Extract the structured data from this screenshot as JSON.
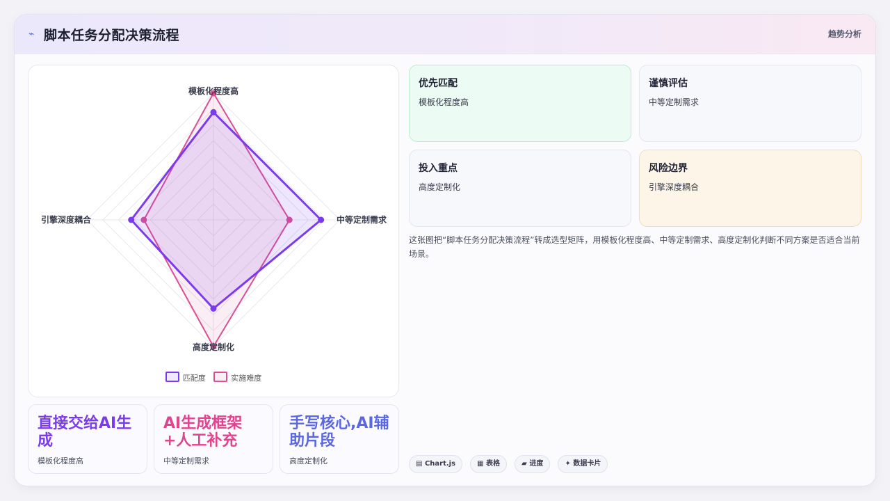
{
  "header": {
    "title": "脚本任务分配决策流程",
    "link": "趋势分析"
  },
  "chart_data": {
    "type": "radar",
    "axes": [
      "模板化程度高",
      "中等定制需求",
      "高度定制化",
      "引擎深度耦合"
    ],
    "scale_max": 10,
    "series": [
      {
        "name": "匹配度",
        "values": [
          8.5,
          8.5,
          7,
          6.5
        ],
        "color": "#7c3aed"
      },
      {
        "name": "实施难度",
        "values": [
          10,
          6,
          10,
          5.5
        ],
        "color": "#db4f95"
      }
    ]
  },
  "options": [
    {
      "title": "直接交给AI生成",
      "sub": "模板化程度高",
      "color": "#7c3aed"
    },
    {
      "title": "AI生成框架+人工补充",
      "sub": "中等定制需求",
      "color": "#e0448f"
    },
    {
      "title": "手写核心,AI辅助片段",
      "sub": "高度定制化",
      "color": "#5b67e0"
    }
  ],
  "quadrants": [
    {
      "title": "优先匹配",
      "sub": "模板化程度高",
      "bg": "#ecfbf3",
      "border": "#bfeccf"
    },
    {
      "title": "谨慎评估",
      "sub": "中等定制需求",
      "bg": "#f7f8fc",
      "border": "#e4e6f0"
    },
    {
      "title": "投入重点",
      "sub": "高度定制化",
      "bg": "#f7f8fc",
      "border": "#e4e6f0"
    },
    {
      "title": "风险边界",
      "sub": "引擎深度耦合",
      "bg": "#fdf5e8",
      "border": "#f3ddb8"
    }
  ],
  "description": "这张图把“脚本任务分配决策流程”转成选型矩阵，用模板化程度高、中等定制需求、高度定制化判断不同方案是否适合当前场景。",
  "chips": [
    {
      "icon": "▤",
      "label": "Chart.js"
    },
    {
      "icon": "▦",
      "label": "表格"
    },
    {
      "icon": "▰",
      "label": "进度"
    },
    {
      "icon": "✦",
      "label": "数据卡片"
    }
  ]
}
